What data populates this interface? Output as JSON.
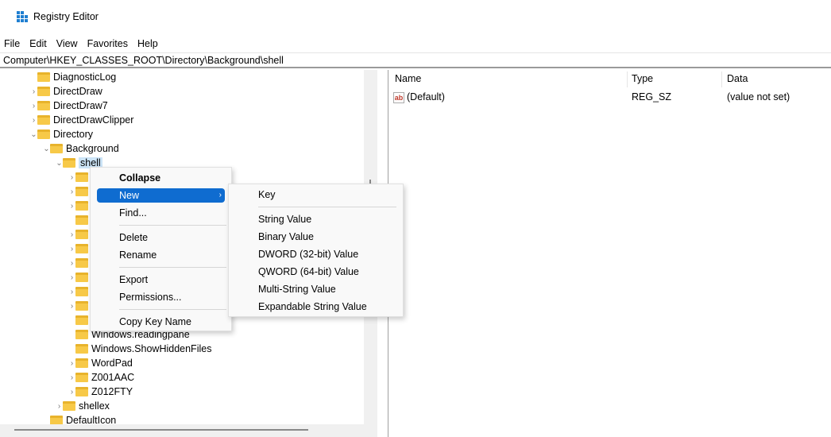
{
  "window": {
    "title": "Registry Editor",
    "icon": "regedit-icon"
  },
  "menubar": [
    "File",
    "Edit",
    "View",
    "Favorites",
    "Help"
  ],
  "address": "Computer\\HKEY_CLASSES_ROOT\\Directory\\Background\\shell",
  "tree": [
    {
      "label": "DiagnosticLog",
      "level": 0,
      "chevron": "none"
    },
    {
      "label": "DirectDraw",
      "level": 0,
      "chevron": "right"
    },
    {
      "label": "DirectDraw7",
      "level": 0,
      "chevron": "right"
    },
    {
      "label": "DirectDrawClipper",
      "level": 0,
      "chevron": "right"
    },
    {
      "label": "Directory",
      "level": 0,
      "chevron": "down"
    },
    {
      "label": "Background",
      "level": 1,
      "chevron": "down"
    },
    {
      "label": "shell",
      "level": 2,
      "chevron": "down",
      "selected": true
    },
    {
      "label": "",
      "level": 3,
      "chevron": "right"
    },
    {
      "label": "",
      "level": 3,
      "chevron": "right"
    },
    {
      "label": "",
      "level": 3,
      "chevron": "right"
    },
    {
      "label": "",
      "level": 3,
      "chevron": "none"
    },
    {
      "label": "",
      "level": 3,
      "chevron": "right"
    },
    {
      "label": "",
      "level": 3,
      "chevron": "right"
    },
    {
      "label": "",
      "level": 3,
      "chevron": "right"
    },
    {
      "label": "",
      "level": 3,
      "chevron": "right"
    },
    {
      "label": "",
      "level": 3,
      "chevron": "right"
    },
    {
      "label": "",
      "level": 3,
      "chevron": "right"
    },
    {
      "label": "",
      "level": 3,
      "chevron": "none"
    },
    {
      "label": "Windows.readingpane",
      "level": 3,
      "chevron": "none"
    },
    {
      "label": "Windows.ShowHiddenFiles",
      "level": 3,
      "chevron": "none"
    },
    {
      "label": "WordPad",
      "level": 3,
      "chevron": "right"
    },
    {
      "label": "Z001AAC",
      "level": 3,
      "chevron": "right"
    },
    {
      "label": "Z012FTY",
      "level": 3,
      "chevron": "right"
    },
    {
      "label": "shellex",
      "level": 2,
      "chevron": "right"
    },
    {
      "label": "DefaultIcon",
      "level": 1,
      "chevron": "none"
    }
  ],
  "list": {
    "columns": [
      "Name",
      "Type",
      "Data"
    ],
    "rows": [
      {
        "name": "(Default)",
        "type": "REG_SZ",
        "data": "(value not set)",
        "icon": "ab"
      }
    ]
  },
  "context_menu": {
    "items": [
      "Collapse",
      "New",
      "Find...",
      "Delete",
      "Rename",
      "Export",
      "Permissions...",
      "Copy Key Name"
    ],
    "highlighted": "New"
  },
  "submenu": {
    "items": [
      "Key",
      "String Value",
      "Binary Value",
      "DWORD (32-bit) Value",
      "QWORD (64-bit) Value",
      "Multi-String Value",
      "Expandable String Value"
    ]
  },
  "colors": {
    "highlight": "#0f6cd0",
    "selection": "#cce4f7",
    "folder": "#f7c948"
  }
}
